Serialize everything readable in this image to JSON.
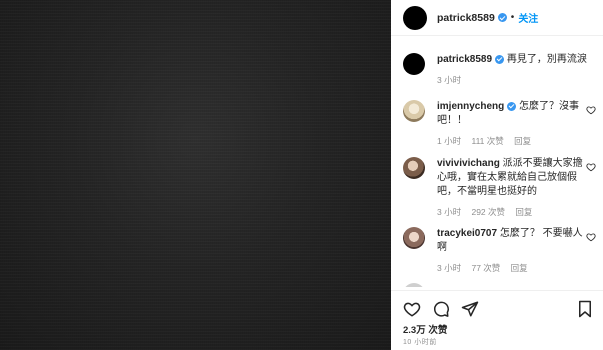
{
  "post": {
    "username": "patrick8589",
    "separator": "•",
    "follow_label": "关注",
    "caption": "再見了，別再流淚",
    "caption_time": "3 小时"
  },
  "comments": [
    {
      "username": "imjennycheng",
      "text": "怎麼了？沒事吧！！",
      "time": "1 小时",
      "likes": "111 次赞",
      "reply": "回复"
    },
    {
      "username": "vivivivichang",
      "text": "派派不要讓大家擔心哦，實在太累就給自己放個假吧，不當明星也挺好的",
      "time": "3 小时",
      "likes": "292 次赞",
      "reply": "回复"
    },
    {
      "username": "tracykei0707",
      "text": "怎麼了？ 不要嚇人啊",
      "time": "3 小时",
      "likes": "77 次赞",
      "reply": "回复"
    }
  ],
  "actions": {
    "likes_count": "2.3万 次赞",
    "timestamp": "10 小时前"
  },
  "icons": {
    "verified": "verified-badge-icon",
    "heart": "heart-icon",
    "comment": "comment-icon",
    "share": "paper-plane-icon",
    "bookmark": "bookmark-icon"
  },
  "colors": {
    "accent": "#0095f6",
    "verified": "#3897f0",
    "secondary_text": "#8e8e8e"
  }
}
